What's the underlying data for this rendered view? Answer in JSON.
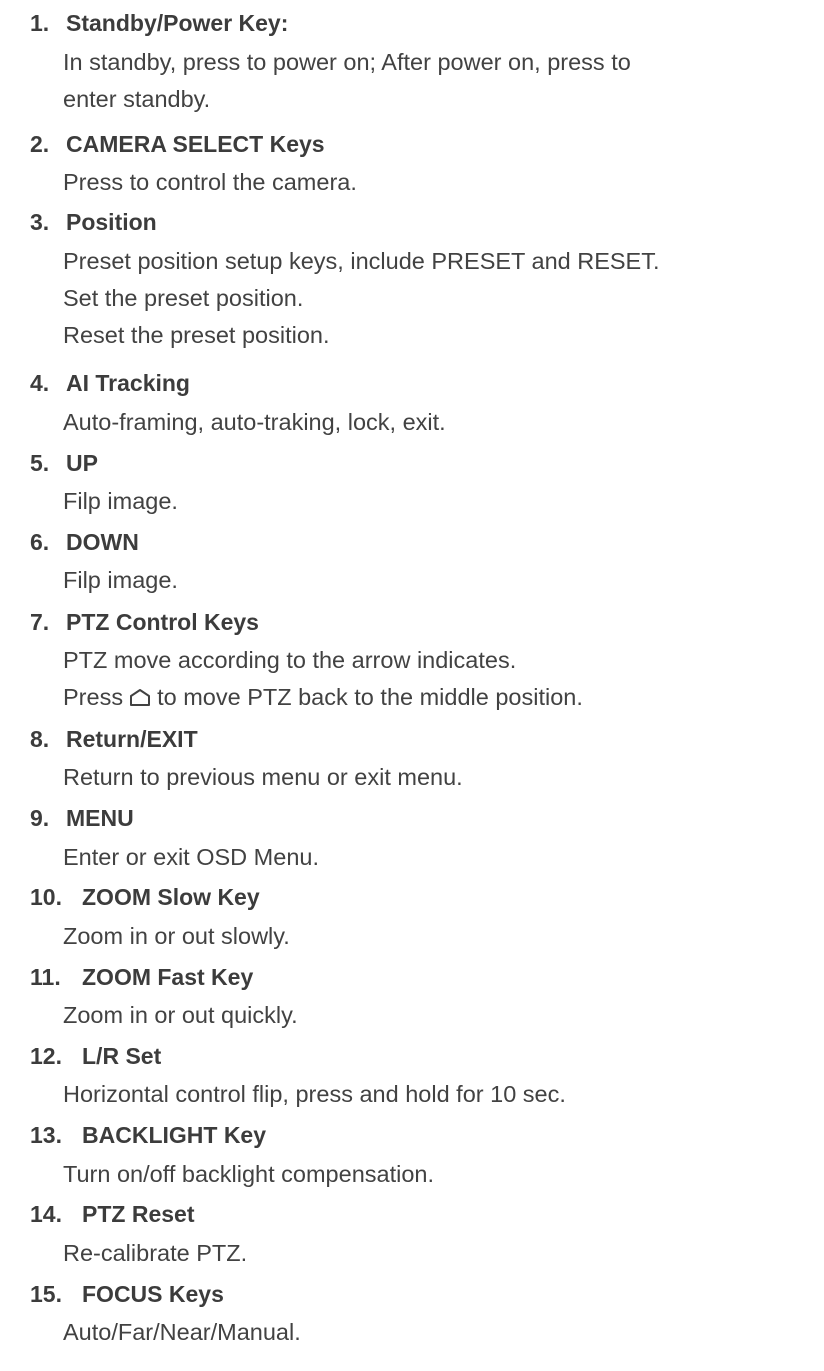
{
  "items": [
    {
      "number": "1.",
      "title": "Standby/Power Key:",
      "lines": [
        "In standby, press to power on; After power on, press to",
        "enter standby."
      ]
    },
    {
      "number": "2.",
      "title": "CAMERA SELECT Keys",
      "lines": [
        "Press to control the camera."
      ]
    },
    {
      "number": "3.",
      "title": "Position",
      "lines": [
        "Preset position setup keys, include PRESET and RESET.",
        "Set the preset position.",
        "Reset the preset position."
      ]
    },
    {
      "number": "4.",
      "title": "AI Tracking",
      "lines": [
        "Auto-framing, auto-traking, lock, exit."
      ]
    },
    {
      "number": "5.",
      "title": "UP",
      "lines": [
        "Filp image."
      ]
    },
    {
      "number": "6.",
      "title": "DOWN",
      "lines": [
        "Filp image."
      ]
    },
    {
      "number": "7.",
      "title": "PTZ Control Keys",
      "lines": [
        "PTZ move according to the arrow indicates."
      ],
      "home_line": {
        "before": "Press",
        "icon": "home-icon",
        "after": "to move PTZ back to the middle position."
      }
    },
    {
      "number": "8.",
      "title": "Return/EXIT",
      "lines": [
        "Return to previous menu or exit menu."
      ]
    },
    {
      "number": "9.",
      "title": "MENU",
      "lines": [
        "Enter or exit OSD Menu."
      ]
    },
    {
      "number": "10.",
      "title": "ZOOM Slow Key",
      "lines": [
        "Zoom in or out  slowly."
      ]
    },
    {
      "number": "11.",
      "title": "ZOOM Fast Key",
      "lines": [
        "Zoom in or out quickly."
      ]
    },
    {
      "number": "12.",
      "title": "L/R Set",
      "lines": [
        "Horizontal control flip, press and hold for 10 sec."
      ]
    },
    {
      "number": "13.",
      "title": "BACKLIGHT Key",
      "lines": [
        "Turn on/off backlight compensation."
      ]
    },
    {
      "number": "14.",
      "title": "PTZ Reset",
      "lines": [
        "Re-calibrate PTZ."
      ]
    },
    {
      "number": "15.",
      "title": "FOCUS Keys",
      "lines": [
        "Auto/Far/Near/Manual."
      ]
    }
  ],
  "colors": {
    "heading": "#3c3c3c",
    "body": "#424242",
    "background": "#ffffff"
  }
}
